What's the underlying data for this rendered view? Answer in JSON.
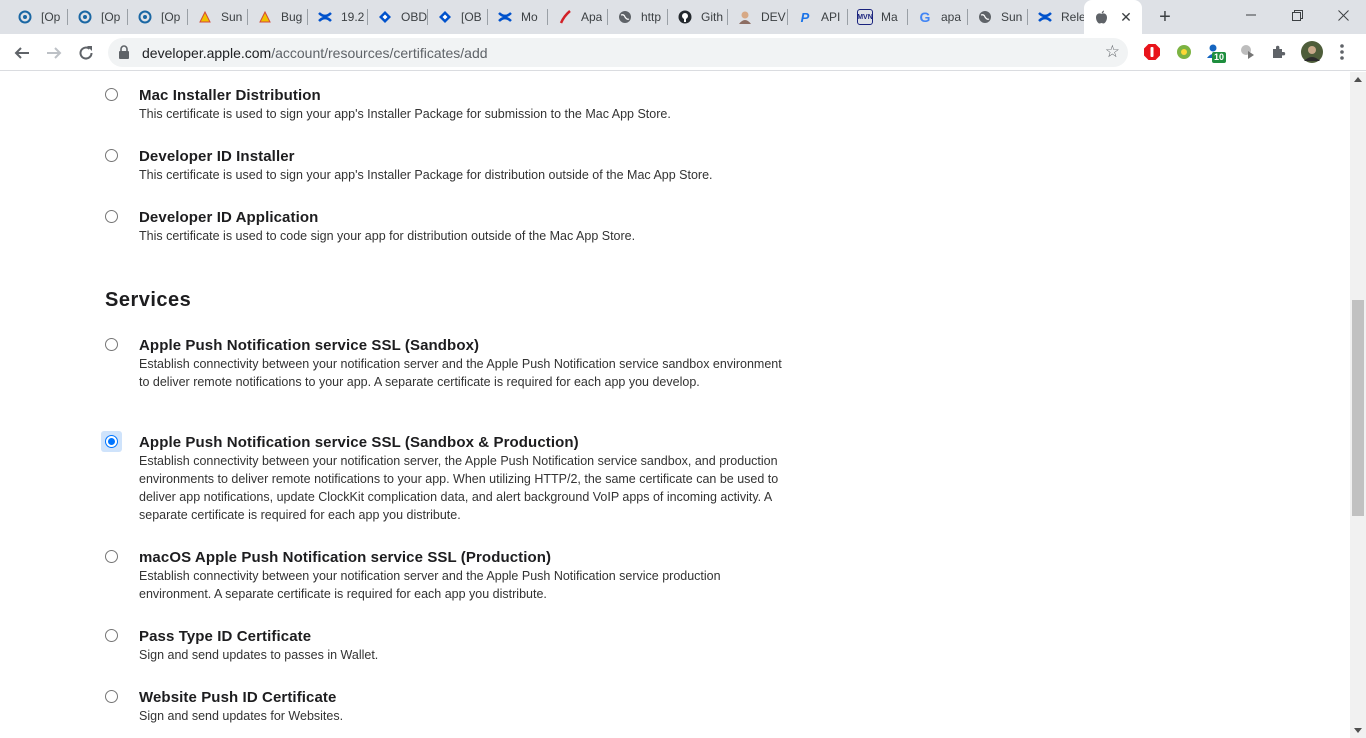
{
  "browser": {
    "tabs": [
      {
        "title": "[Op",
        "icon": "openproject-icon",
        "color": "#1a67a3"
      },
      {
        "title": "[Op",
        "icon": "openproject-icon",
        "color": "#1a67a3"
      },
      {
        "title": "[Op",
        "icon": "openproject-icon",
        "color": "#1a67a3"
      },
      {
        "title": "Sun",
        "icon": "jenkins-icon",
        "color": "#d24939"
      },
      {
        "title": "Bug",
        "icon": "jenkins-icon",
        "color": "#d24939"
      },
      {
        "title": "19.2",
        "icon": "confluence-icon",
        "color": "#0052cc"
      },
      {
        "title": "OBD",
        "icon": "jira-icon",
        "color": "#0052cc"
      },
      {
        "title": "[OB",
        "icon": "jira-icon",
        "color": "#0052cc"
      },
      {
        "title": "Mo",
        "icon": "confluence-icon",
        "color": "#0052cc"
      },
      {
        "title": "Apa",
        "icon": "apache-feather-icon",
        "color": "#d22128"
      },
      {
        "title": "http",
        "icon": "globe-icon",
        "color": "#5f6368"
      },
      {
        "title": "Gith",
        "icon": "github-icon",
        "color": "#24292e"
      },
      {
        "title": "DEV",
        "icon": "dev-avatar-icon",
        "color": "#8d6e63"
      },
      {
        "title": "API",
        "icon": "postman-p-icon",
        "color": "#1a73e8"
      },
      {
        "title": "Ma",
        "icon": "maven-mvn-icon",
        "color": "#1a237e"
      },
      {
        "title": "apa",
        "icon": "google-g-icon",
        "color": "#4285f4"
      },
      {
        "title": "Sun",
        "icon": "globe-icon",
        "color": "#5f6368"
      },
      {
        "title": "Rele",
        "icon": "confluence-icon",
        "color": "#0052cc"
      },
      {
        "title": "",
        "icon": "apple-icon",
        "color": "#5f6368"
      }
    ],
    "new_tab_label": "+",
    "address": {
      "host": "developer.apple.com",
      "path": "/account/resources/certificates/add"
    },
    "extension_badge": "10"
  },
  "page": {
    "mac_options": [
      {
        "title": "Mac Installer Distribution",
        "desc": "This certificate is used to sign your app's Installer Package for submission to the Mac App Store.",
        "checked": false
      },
      {
        "title": "Developer ID Installer",
        "desc": "This certificate is used to sign your app's Installer Package for distribution outside of the Mac App Store.",
        "checked": false
      },
      {
        "title": "Developer ID Application",
        "desc": "This certificate is used to code sign your app for distribution outside of the Mac App Store.",
        "checked": false
      }
    ],
    "services_heading": "Services",
    "service_options": [
      {
        "title": "Apple Push Notification service SSL (Sandbox)",
        "desc": "Establish connectivity between your notification server and the Apple Push Notification service sandbox environment to deliver remote notifications to your app. A separate certificate is required for each app you develop.",
        "checked": false
      },
      {
        "title": "Apple Push Notification service SSL (Sandbox & Production)",
        "desc": "Establish connectivity between your notification server, the Apple Push Notification service sandbox, and production environments to deliver remote notifications to your app. When utilizing HTTP/2, the same certificate can be used to deliver app notifications, update ClockKit complication data, and alert background VoIP apps of incoming activity. A separate certificate is required for each app you distribute.",
        "checked": true
      },
      {
        "title": "macOS Apple Push Notification service SSL (Production)",
        "desc": "Establish connectivity between your notification server and the Apple Push Notification service production environment. A separate certificate is required for each app you distribute.",
        "checked": false
      },
      {
        "title": "Pass Type ID Certificate",
        "desc": "Sign and send updates to passes in Wallet.",
        "checked": false
      },
      {
        "title": "Website Push ID Certificate",
        "desc": "Sign and send updates for Websites.",
        "checked": false
      }
    ]
  }
}
